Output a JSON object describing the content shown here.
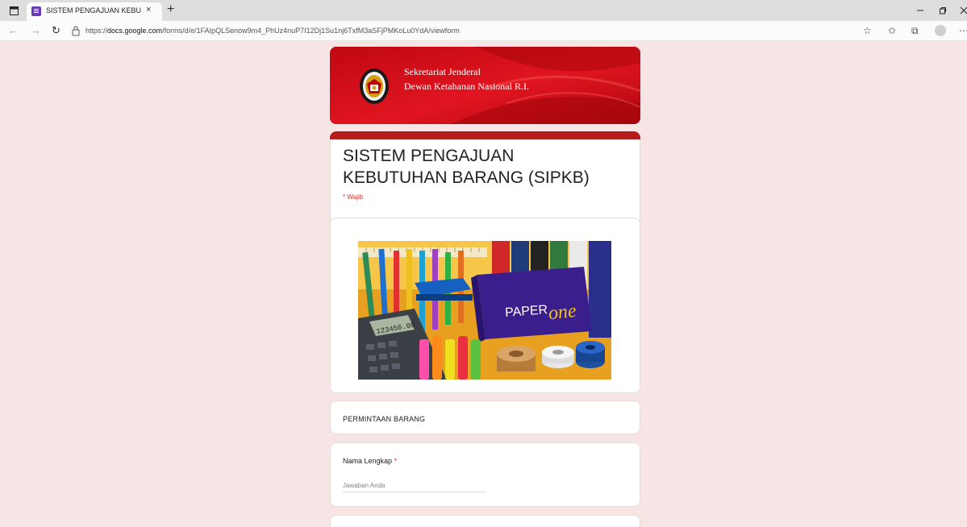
{
  "browser": {
    "tab_title": "SISTEM PENGAJUAN KEBUTUHA",
    "tab_close": "×",
    "new_tab": "+",
    "url_prefix": "https://",
    "url_domain": "docs.google.com",
    "url_path": "/forms/d/e/1FAIpQLSenow9m4_PhUz4nuP7I12Dj1Su1nj6TxfM3aSFjPMKoLu0YdA/viewform",
    "icons": [
      "back-icon",
      "forward-icon",
      "refresh-icon",
      "lock-icon",
      "read-aloud-icon",
      "favorites-icon",
      "collections-icon",
      "profile-icon",
      "more-icon"
    ]
  },
  "header": {
    "org_line1": "Sekretariat Jenderal",
    "org_line2": "Dewan Ketahanan Nasional R.I.",
    "brand_color": "#d80f18"
  },
  "form": {
    "title": "SISTEM PENGAJUAN KEBUTUHAN BARANG (SIPKB)",
    "required_note": "* Wajib",
    "accent_color": "#b71c1c",
    "image": {
      "brand_text": "PAPER",
      "brand_script": "one",
      "calculator_display": "123456.00"
    },
    "section_title": "PERMINTAAN BARANG",
    "question": {
      "label": "Nama Lengkap",
      "required_mark": "*",
      "placeholder": "Jawaban Anda"
    }
  },
  "background_color": "#f7e4e5"
}
